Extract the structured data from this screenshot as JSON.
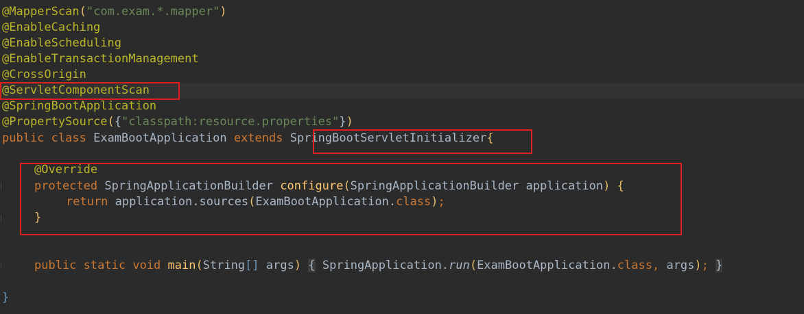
{
  "editor": {
    "lines": {
      "l1": {
        "at": "@",
        "name": "MapperScan",
        "open": "(",
        "arg": "\"com.exam.*.mapper\"",
        "close": ")"
      },
      "l2": {
        "text": "@EnableCaching"
      },
      "l3": {
        "text": "@EnableScheduling"
      },
      "l4": {
        "text": "@EnableTransactionManagement"
      },
      "l5": {
        "text": "@CrossOrigin"
      },
      "l6": {
        "text": "@ServletComponentScan"
      },
      "l7": {
        "text": "@SpringBootApplication"
      },
      "l8": {
        "name": "@PropertySource",
        "open": "(",
        "lbrace": "{",
        "arg": "\"classpath:resource.properties\"",
        "rbrace": "}",
        "close": ")"
      },
      "l9": {
        "kw1": "public",
        "kw2": "class",
        "cls": "ExamBootApplication",
        "kw3": "extends",
        "parent": "SpringBootServletInitializer",
        "brace": "{"
      },
      "l11": {
        "text": "@Override"
      },
      "l12": {
        "kw": "protected",
        "type": "SpringApplicationBuilder",
        "method": "configure",
        "open": "(",
        "ptype": "SpringApplicationBuilder",
        "param": "application",
        "close": ")",
        "brace": "{"
      },
      "l13": {
        "kw": "return",
        "expr1": "application.sources",
        "open": "(",
        "cls": "ExamBootApplication.",
        "kwclass": "class",
        "close": ")",
        "semi": ";"
      },
      "l14": {
        "brace": "}"
      },
      "l16": {
        "kw1": "public",
        "kw2": "static",
        "kw3": "void",
        "method": "main",
        "open": "(",
        "type": "String",
        "arr": "[]",
        "param": "args",
        "close": ")",
        "lbrace": "{",
        "cls": "SpringApplication.",
        "call": "run",
        "open2": "(",
        "cls2": "ExamBootApplication.",
        "kwclass": "class",
        "comma": ",",
        "arg2": "args",
        "close2": ")",
        "semi": ";",
        "rbrace": "}"
      },
      "l18": {
        "brace": "}"
      }
    },
    "colors": {
      "background": "#2b2b2b",
      "annotation": "#bbb529",
      "keyword": "#cc7832",
      "string": "#6a8759",
      "method": "#ffc66d",
      "plain": "#a9b7c6",
      "highlight_box": "#e02020"
    }
  }
}
